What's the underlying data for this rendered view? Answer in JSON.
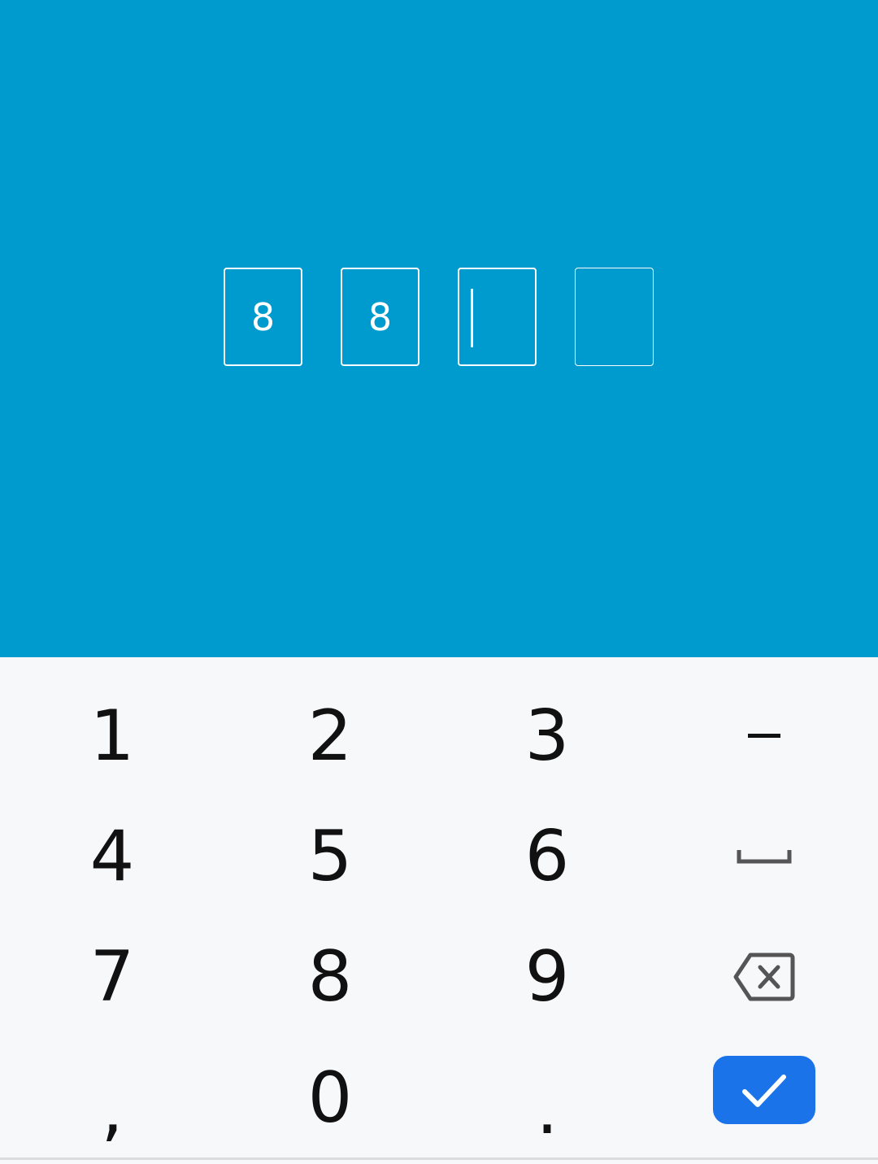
{
  "pin": {
    "digits": [
      "8",
      "8",
      "",
      ""
    ],
    "active_index": 2
  },
  "keypad": {
    "keys": {
      "k1": "1",
      "k2": "2",
      "k3": "3",
      "k4": "4",
      "k5": "5",
      "k6": "6",
      "k7": "7",
      "k8": "8",
      "k9": "9",
      "comma": ",",
      "k0": "0",
      "period": "."
    },
    "icons": {
      "dash": "minus-icon",
      "space": "space-bar-icon",
      "backspace": "backspace-icon",
      "confirm": "checkmark-icon"
    }
  },
  "colors": {
    "header_bg": "#009bce",
    "keypad_bg": "#f7f8fa",
    "confirm_bg": "#1a73e8",
    "key_text": "#111111",
    "icon_gray": "#555555"
  }
}
